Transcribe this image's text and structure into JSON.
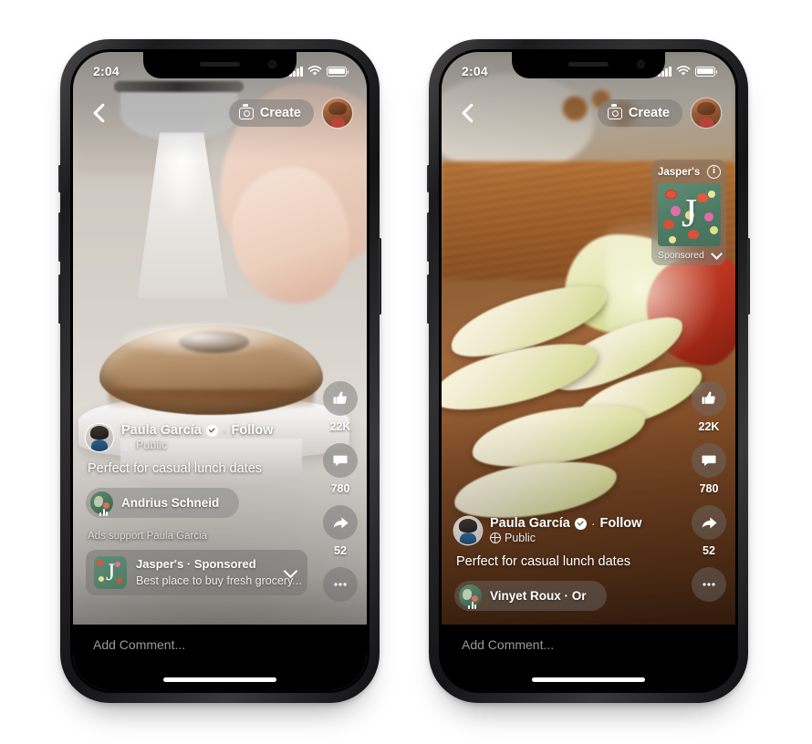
{
  "page": {
    "background": "#ffffff",
    "device_count": 2
  },
  "status_bar": {
    "time": "2:04",
    "signal_icon": "signal-bars-icon",
    "wifi_icon": "wifi-icon",
    "battery_icon": "battery-icon"
  },
  "top_nav": {
    "back_icon": "back-chevron-icon",
    "create_label": "Create",
    "camera_icon": "camera-icon",
    "profile_avatar": "profile-avatar"
  },
  "action_rail": {
    "like": {
      "icon": "thumbs-up-icon",
      "count": "22K"
    },
    "comment": {
      "icon": "comment-bubble-icon",
      "count": "780"
    },
    "share": {
      "icon": "share-arrow-icon",
      "count": "52"
    },
    "more": {
      "icon": "ellipsis-icon"
    }
  },
  "post": {
    "author_name": "Paula García",
    "verified_icon": "verified-badge-icon",
    "separator": "·",
    "follow_label": "Follow",
    "privacy_icon": "globe-icon",
    "privacy_label": "Public",
    "caption": "Perfect for casual lunch dates"
  },
  "comment_bar": {
    "placeholder": "Add Comment..."
  },
  "left_phone": {
    "audio_attribution": "Andrius Schneid",
    "ads_support_text": "Ads support Paula Garcia",
    "sponsor": {
      "title": "Jasper's · Sponsored",
      "subtitle": "Best place to buy fresh grocery...",
      "thumb_letter": "J",
      "chevron_icon": "chevron-down-icon",
      "brand_color": "#5f8d74"
    },
    "scene": "hand dusting powdered sugar over bundt cake"
  },
  "right_phone": {
    "audio_attribution": "Vinyet Roux · Or",
    "ad_card": {
      "name": "Jasper's",
      "info_icon": "info-circle-icon",
      "info_glyph": "i",
      "thumb_letter": "J",
      "sponsored_label": "Sponsored",
      "chevron_icon": "chevron-down-icon",
      "brand_color": "#5f8d74"
    },
    "scene": "sliced apples on wooden cutting board"
  },
  "colors": {
    "screen_black": "#000000",
    "overlay_pill": "rgba(120,120,120,0.48)",
    "text_primary": "#ffffff",
    "text_secondary": "#e9e9e9",
    "placeholder": "#9a9a9a"
  }
}
